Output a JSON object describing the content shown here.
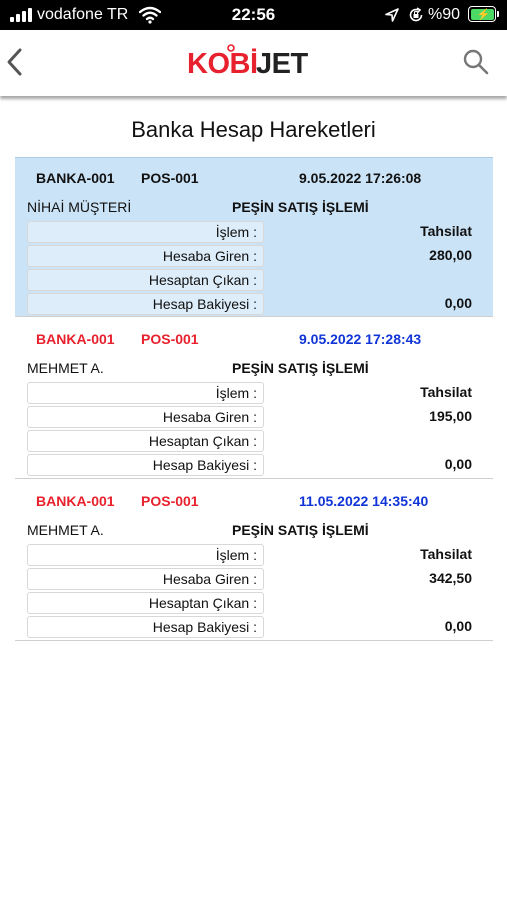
{
  "status_bar": {
    "carrier": "vodafone TR",
    "time": "22:56",
    "battery": "%90",
    "icons": [
      "signal-icon",
      "wifi-icon",
      "location-icon",
      "rotation-lock-icon",
      "battery-charging-icon"
    ]
  },
  "nav": {
    "back_icon": "chevron-left-icon",
    "logo": {
      "part1": "KOBİ",
      "part2": "JET"
    },
    "search_icon": "search-icon"
  },
  "page": {
    "title": "Banka Hesap Hareketleri"
  },
  "labels": {
    "islem": "İşlem :",
    "hesaba_giren": "Hesaba Giren :",
    "hesaptan_cikan": "Hesaptan Çıkan :",
    "hesap_bakiyesi": "Hesap Bakiyesi :"
  },
  "records": [
    {
      "bank": "BANKA-001",
      "pos": "POS-001",
      "date": "9.05.2022 17:26:08",
      "customer": "NİHAİ MÜŞTERİ",
      "type": "PEŞİN SATIŞ İŞLEMİ",
      "islem": "Tahsilat",
      "hesaba_giren": "280,00",
      "hesaptan_cikan": "",
      "hesap_bakiyesi": "0,00",
      "selected": true
    },
    {
      "bank": "BANKA-001",
      "pos": "POS-001",
      "date": "9.05.2022 17:28:43",
      "customer": "MEHMET A.",
      "type": "PEŞİN SATIŞ İŞLEMİ",
      "islem": "Tahsilat",
      "hesaba_giren": "195,00",
      "hesaptan_cikan": "",
      "hesap_bakiyesi": "0,00",
      "selected": false
    },
    {
      "bank": "BANKA-001",
      "pos": "POS-001",
      "date": "11.05.2022 14:35:40",
      "customer": "MEHMET A.",
      "type": "PEŞİN SATIŞ İŞLEMİ",
      "islem": "Tahsilat",
      "hesaba_giren": "342,50",
      "hesaptan_cikan": "",
      "hesap_bakiyesi": "0,00",
      "selected": false
    }
  ],
  "colors": {
    "logo_red": "#e8212e",
    "logo_dark": "#222222",
    "selected_bg": "#cbe3f6",
    "alt_id_red": "#e8212e",
    "alt_date_blue": "#1034d8"
  }
}
